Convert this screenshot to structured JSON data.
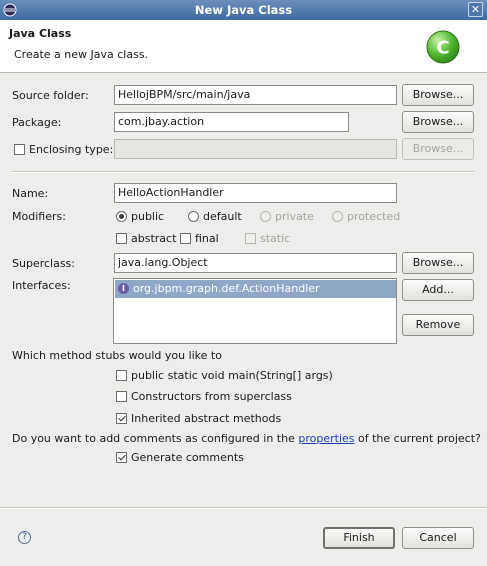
{
  "window": {
    "title": "New Java Class",
    "close_glyph": "✕"
  },
  "banner": {
    "title": "Java Class",
    "description": "Create a new Java class.",
    "logo_letter": "C"
  },
  "source_folder": {
    "label": "Source folder:",
    "value": "HellojBPM/src/main/java",
    "browse": "Browse..."
  },
  "package": {
    "label": "Package:",
    "value": "com.jbay.action",
    "browse": "Browse..."
  },
  "enclosing_type": {
    "label": "Enclosing type:",
    "checked": false,
    "value": "",
    "browse": "Browse..."
  },
  "name": {
    "label": "Name:",
    "value": "HelloActionHandler"
  },
  "modifiers": {
    "label": "Modifiers:",
    "public": "public",
    "default": "default",
    "private": "private",
    "protected": "protected",
    "abstract": "abstract",
    "final": "final",
    "static": "static"
  },
  "superclass": {
    "label": "Superclass:",
    "value": "java.lang.Object",
    "browse": "Browse..."
  },
  "interfaces": {
    "label": "Interfaces:",
    "items": [
      "org.jbpm.graph.def.ActionHandler"
    ],
    "add": "Add...",
    "remove": "Remove"
  },
  "stubs": {
    "question": "Which method stubs would you like to",
    "main": "public static void main(String[] args)",
    "constructors": "Constructors from superclass",
    "inherited": "Inherited abstract methods"
  },
  "comments": {
    "question_prefix": "Do you want to add comments as configured in the ",
    "link": "properties",
    "question_suffix": " of the current project?",
    "generate": "Generate comments"
  },
  "footer": {
    "help_glyph": "?",
    "finish": "Finish",
    "cancel": "Cancel"
  },
  "colors": {
    "titlebar": "#3f6aa1",
    "selection": "#8fa6c7",
    "link": "#1e3fb5",
    "logo": "#4fb82e"
  }
}
